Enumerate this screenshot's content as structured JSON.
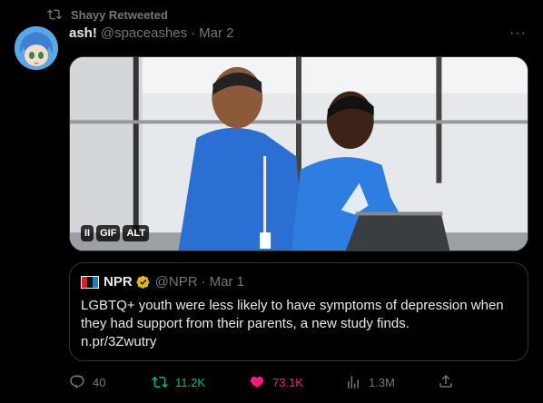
{
  "retweet": {
    "label": "Shayy Retweeted"
  },
  "tweet": {
    "name": "ash!",
    "handle": "@spaceashes",
    "separator": "·",
    "date": "Mar 2",
    "more": "···"
  },
  "media": {
    "badges": [
      "II",
      "GIF",
      "ALT"
    ]
  },
  "quote": {
    "name": "NPR",
    "handle": "@NPR",
    "separator": "·",
    "date": "Mar 1",
    "text": "LGBTQ+ youth were less likely to have symptoms of depression when they had support from their parents, a new study finds.",
    "link": "n.pr/3Zwutry"
  },
  "actions": {
    "replies": "40",
    "retweets": "11.2K",
    "likes": "73.1K",
    "views": "1.3M"
  },
  "colors": {
    "retweet": "#00ba7c",
    "like": "#f91880",
    "muted": "#71767b",
    "verified": "#f4b400"
  }
}
